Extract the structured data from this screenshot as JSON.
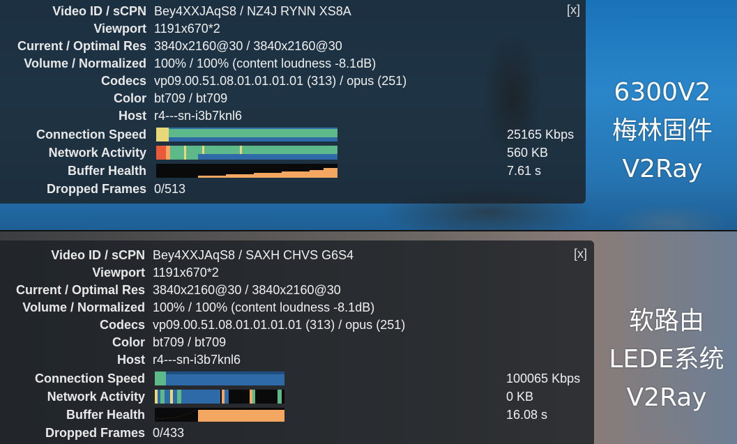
{
  "top_panel": {
    "close_label": "[x]",
    "rows": [
      {
        "label": "Video ID / sCPN",
        "value": "Bey4XXJAqS8 / NZ4J RYNN XS8A"
      },
      {
        "label": "Viewport",
        "value": "1191x670*2"
      },
      {
        "label": "Current / Optimal Res",
        "value": "3840x2160@30 / 3840x2160@30"
      },
      {
        "label": "Volume / Normalized",
        "value": "100% / 100% (content loudness -8.1dB)"
      },
      {
        "label": "Codecs",
        "value": "vp09.00.51.08.01.01.01.01 (313) / opus (251)"
      },
      {
        "label": "Color",
        "value": "bt709 / bt709"
      },
      {
        "label": "Host",
        "value": "r4---sn-i3b7knl6"
      }
    ],
    "graphs": [
      {
        "label": "Connection Speed",
        "value": "25165 Kbps"
      },
      {
        "label": "Network Activity",
        "value": "560 KB"
      },
      {
        "label": "Buffer Health",
        "value": "7.61 s"
      }
    ],
    "dropped": {
      "label": "Dropped Frames",
      "value": "0/513"
    }
  },
  "bottom_panel": {
    "close_label": "[x]",
    "rows": [
      {
        "label": "Video ID / sCPN",
        "value": "Bey4XXJAqS8 / SAXH CHVS G6S4"
      },
      {
        "label": "Viewport",
        "value": "1191x670*2"
      },
      {
        "label": "Current / Optimal Res",
        "value": "3840x2160@30 / 3840x2160@30"
      },
      {
        "label": "Volume / Normalized",
        "value": "100% / 100% (content loudness -8.1dB)"
      },
      {
        "label": "Codecs",
        "value": "vp09.00.51.08.01.01.01.01 (313) / opus (251)"
      },
      {
        "label": "Color",
        "value": "bt709 / bt709"
      },
      {
        "label": "Host",
        "value": "r4---sn-i3b7knl6"
      }
    ],
    "graphs": [
      {
        "label": "Connection Speed",
        "value": "100065 Kbps"
      },
      {
        "label": "Network Activity",
        "value": "0 KB"
      },
      {
        "label": "Buffer Health",
        "value": "16.08 s"
      }
    ],
    "dropped": {
      "label": "Dropped Frames",
      "value": "0/433"
    }
  },
  "overlay_top": {
    "line1": "6300V2",
    "line2": "梅林固件",
    "line3": "V2Ray"
  },
  "overlay_bottom": {
    "line1": "软路由",
    "line2": "LEDE系统",
    "line3": "V2Ray"
  },
  "colors": {
    "graph_green": "#5db88a",
    "graph_blue": "#2f6aa8",
    "graph_orange": "#f4a761",
    "graph_yellow": "#e8d87a",
    "graph_red": "#e85a3a",
    "graph_bg": "#0a0a0a"
  }
}
